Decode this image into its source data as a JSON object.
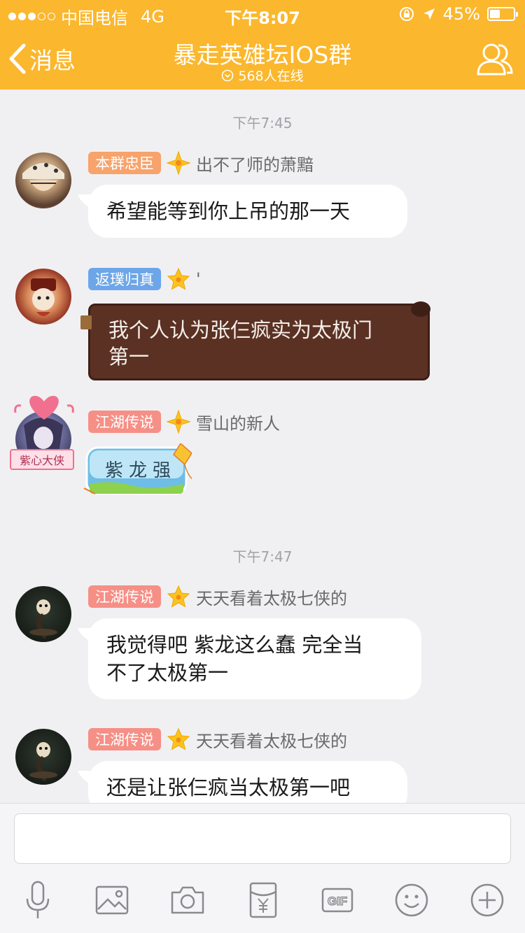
{
  "status_bar": {
    "carrier": "中国电信",
    "network": "4G",
    "time": "下午8:07",
    "battery": "45%"
  },
  "nav": {
    "back_label": "消息",
    "title": "暴走英雄坛IOS群",
    "online": "568人在线"
  },
  "messages": [
    {
      "time": "下午7:45"
    },
    {
      "badge": "本群忠臣",
      "badge_color": "#f7a36b",
      "name": "出不了师的萧黯",
      "text": "希望能等到你上吊的那一天"
    },
    {
      "badge": "返璞归真",
      "badge_color": "#6ca6e8",
      "name": "'",
      "text_line1": "我个人认为张仨疯实为太极门",
      "text_line2": "第一"
    },
    {
      "badge": "江湖传说",
      "badge_color": "#f68f86",
      "name": "雪山的新人",
      "text": "紫龙强",
      "avatar_caption": "紫心大侠"
    },
    {
      "time": "下午7:47"
    },
    {
      "badge": "江湖传说",
      "badge_color": "#f68f86",
      "name": "天天看着太极七侠的",
      "text_line1": "我觉得吧 紫龙这么蠢 完全当",
      "text_line2": "不了太极第一"
    },
    {
      "badge": "江湖传说",
      "badge_color": "#f68f86",
      "name": "天天看着太极七侠的",
      "text": "还是让张仨疯当太极第一吧"
    }
  ],
  "colors": {
    "brand": "#fbb72d",
    "background": "#f0f0f2",
    "chocolate": "#5b3124",
    "kite_blue": "#6dbde6"
  },
  "toolbar_icons": [
    "microphone-icon",
    "image-icon",
    "camera-icon",
    "red-envelope-icon",
    "gif-icon",
    "emoji-icon",
    "plus-icon"
  ]
}
